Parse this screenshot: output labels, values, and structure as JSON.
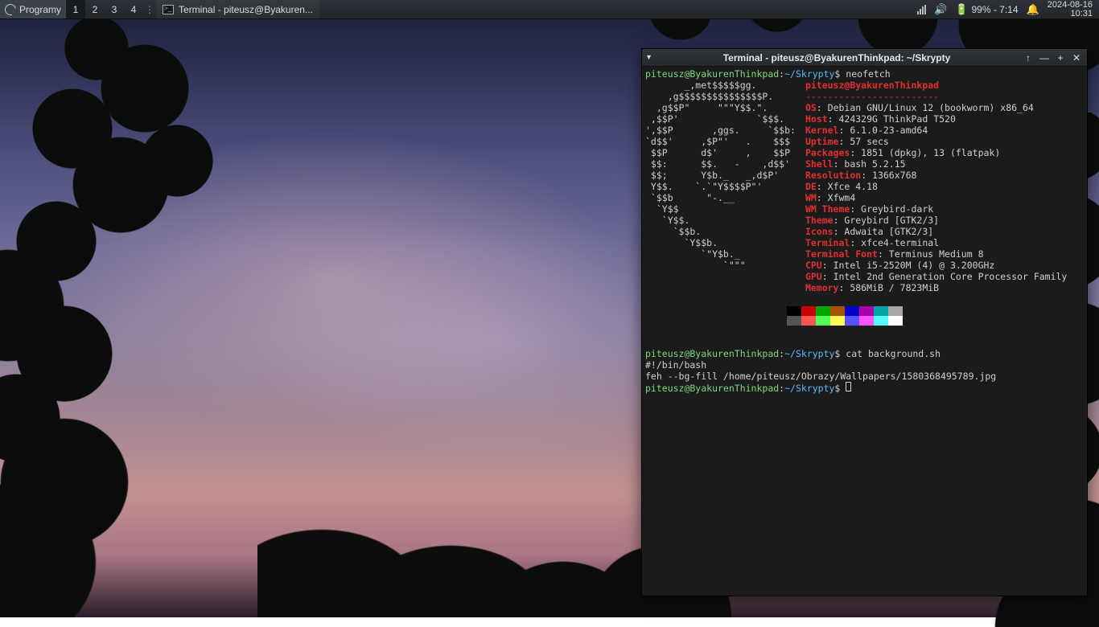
{
  "panel": {
    "menu_label": "Programy",
    "workspaces": [
      "1",
      "2",
      "3",
      "4"
    ],
    "active_workspace": 0,
    "task_title": "Terminal - piteusz@Byakuren...",
    "battery": "99% - 7:14",
    "clock_date": "2024-08-16",
    "clock_time": "10:31"
  },
  "window": {
    "title": "Terminal - piteusz@ByakurenThinkpad: ~/Skrypty"
  },
  "prompt": {
    "user_host": "piteusz@ByakurenThinkpad",
    "sep": ":",
    "path": "~/Skrypty",
    "symbol": "$"
  },
  "cmd1": "neofetch",
  "cmd2": "cat background.sh",
  "cat_output": {
    "l1": "#!/bin/bash",
    "l2": "feh --bg-fill /home/piteusz/Obrazy/Wallpapers/1580368495789.jpg"
  },
  "ascii": [
    "       _,met$$$$$gg.",
    "    ,g$$$$$$$$$$$$$$$P.",
    "  ,g$$P\"     \"\"\"Y$$.\".",
    " ,$$P'              `$$$.",
    "',$$P       ,ggs.     `$$b:",
    "`d$$'     ,$P\"'   .    $$$",
    " $$P      d$'     ,    $$P",
    " $$:      $$.   -    ,d$$'",
    " $$;      Y$b._   _,d$P'",
    " Y$$.    `.`\"Y$$$$P\"'",
    " `$$b      \"-.__",
    "  `Y$$",
    "   `Y$$.",
    "     `$$b.",
    "       `Y$$b.",
    "          `\"Y$b._",
    "              `\"\"\""
  ],
  "neofetch": {
    "userhost": "piteusz@ByakurenThinkpad",
    "dashes": "------------------------",
    "fields": [
      {
        "k": "OS",
        "v": "Debian GNU/Linux 12 (bookworm) x86_64"
      },
      {
        "k": "Host",
        "v": "424329G ThinkPad T520"
      },
      {
        "k": "Kernel",
        "v": "6.1.0-23-amd64"
      },
      {
        "k": "Uptime",
        "v": "57 secs"
      },
      {
        "k": "Packages",
        "v": "1851 (dpkg), 13 (flatpak)"
      },
      {
        "k": "Shell",
        "v": "bash 5.2.15"
      },
      {
        "k": "Resolution",
        "v": "1366x768"
      },
      {
        "k": "DE",
        "v": "Xfce 4.18"
      },
      {
        "k": "WM",
        "v": "Xfwm4"
      },
      {
        "k": "WM Theme",
        "v": "Greybird-dark"
      },
      {
        "k": "Theme",
        "v": "Greybird [GTK2/3]"
      },
      {
        "k": "Icons",
        "v": "Adwaita [GTK2/3]"
      },
      {
        "k": "Terminal",
        "v": "xfce4-terminal"
      },
      {
        "k": "Terminal Font",
        "v": "Terminus Medium 8"
      },
      {
        "k": "CPU",
        "v": "Intel i5-2520M (4) @ 3.200GHz"
      },
      {
        "k": "GPU",
        "v": "Intel 2nd Generation Core Processor Family"
      },
      {
        "k": "Memory",
        "v": "586MiB / 7823MiB"
      }
    ]
  },
  "colors": {
    "row1": [
      "#000000",
      "#cc0000",
      "#00a800",
      "#a85400",
      "#0000cc",
      "#a800a8",
      "#00a8a8",
      "#a8a8a8"
    ],
    "row2": [
      "#545454",
      "#ff5454",
      "#54ff54",
      "#ffff54",
      "#5454ff",
      "#ff54ff",
      "#54ffff",
      "#ffffff"
    ]
  }
}
